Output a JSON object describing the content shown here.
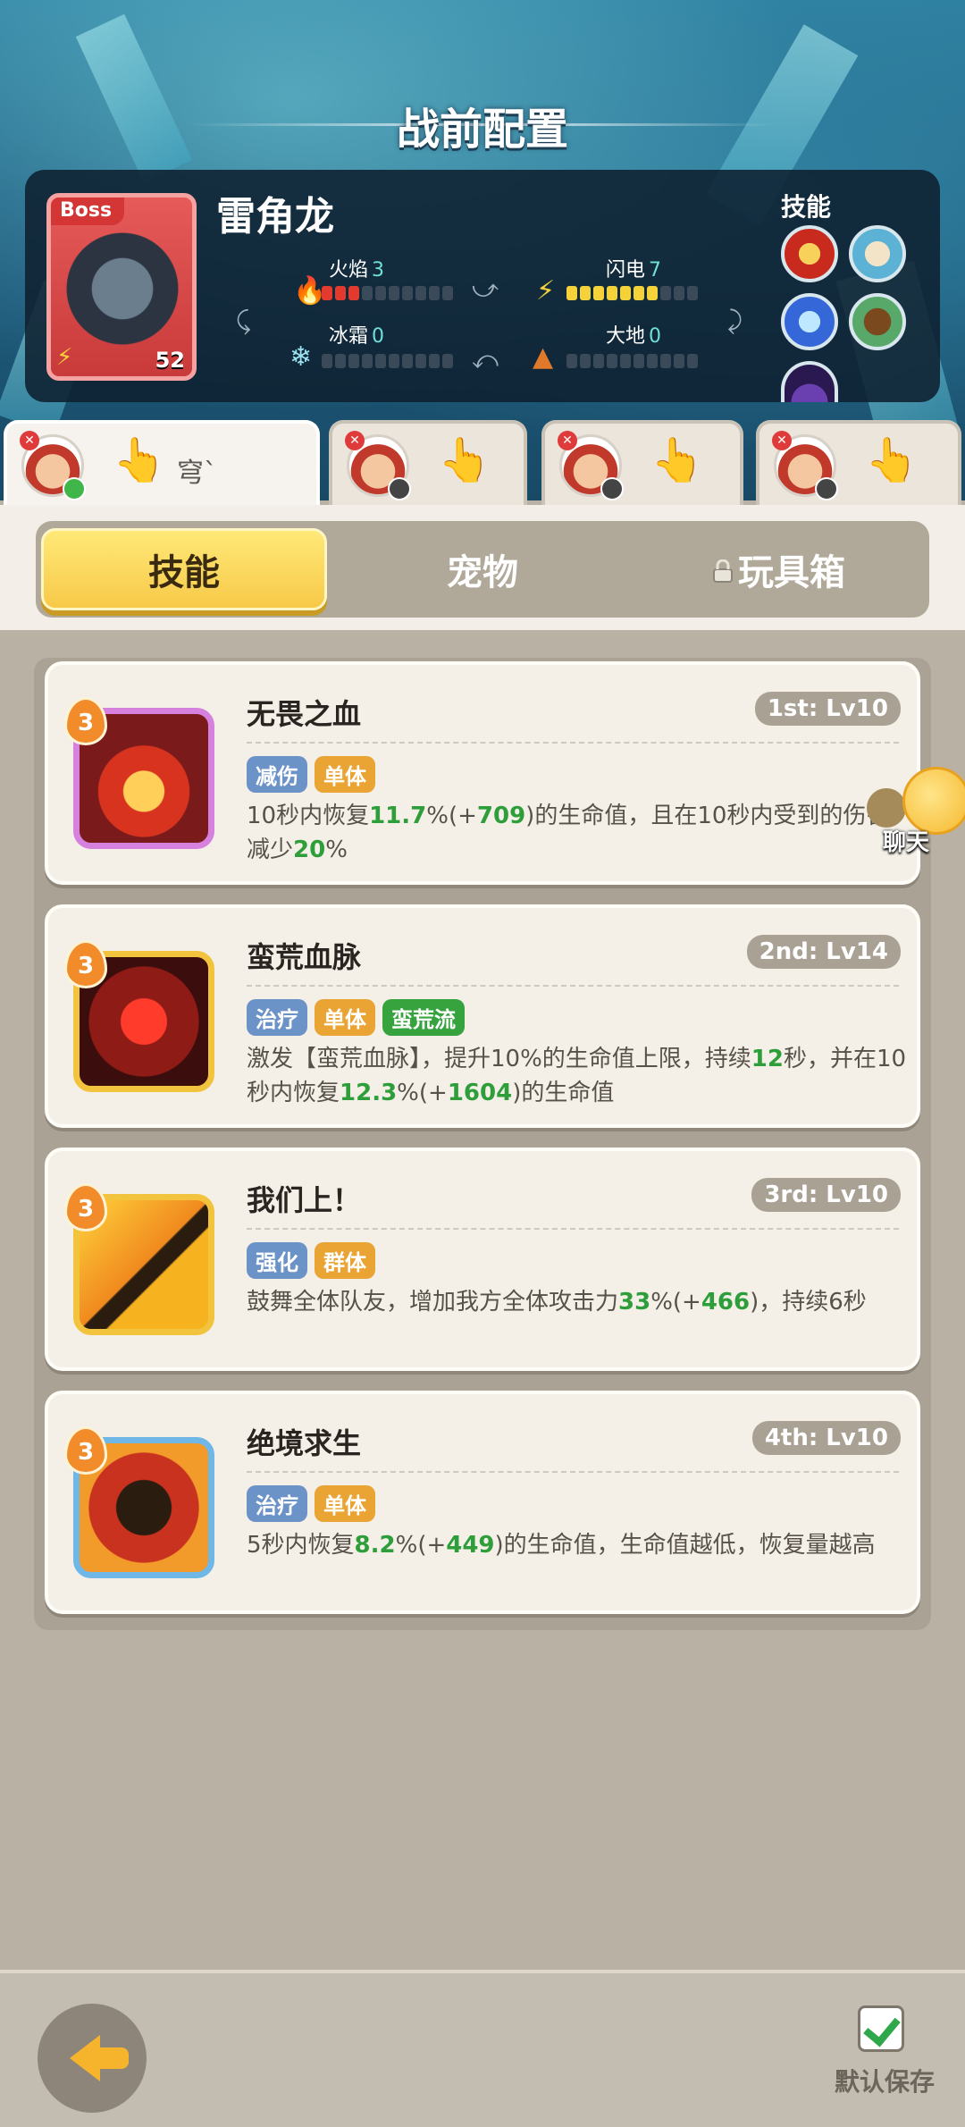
{
  "header": {
    "title": "战前配置"
  },
  "boss": {
    "tag": "Boss",
    "name": "雷角龙",
    "level": "52",
    "skills_label": "技能",
    "stats": [
      {
        "key": "fire",
        "label": "火焰",
        "value": "3",
        "filled": 3,
        "total": 10,
        "icon": "fire-drop-icon"
      },
      {
        "key": "thunder",
        "label": "闪电",
        "value": "7",
        "filled": 7,
        "total": 10,
        "icon": "lightning-icon"
      },
      {
        "key": "frost",
        "label": "冰霜",
        "value": "0",
        "filled": 0,
        "total": 10,
        "icon": "snowflake-icon"
      },
      {
        "key": "earth",
        "label": "大地",
        "value": "0",
        "filled": 0,
        "total": 10,
        "icon": "mountain-icon"
      }
    ],
    "skill_icons": [
      "fire-skill-icon",
      "shield-skill-icon",
      "lightning-skill-icon",
      "monster-skill-icon",
      "dark-skill-icon"
    ]
  },
  "hero_tabs": [
    {
      "active": true,
      "text": "穹`",
      "badge": "green"
    },
    {
      "active": false,
      "text": "",
      "badge": "dark"
    },
    {
      "active": false,
      "text": "",
      "badge": "dark"
    },
    {
      "active": false,
      "text": "",
      "badge": "dark"
    }
  ],
  "categories": [
    {
      "label": "技能",
      "active": true,
      "locked": false
    },
    {
      "label": "宠物",
      "active": false,
      "locked": false
    },
    {
      "label": "玩具箱",
      "active": false,
      "locked": true
    }
  ],
  "skills": [
    {
      "level": "3",
      "name": "无畏之血",
      "rank": "1st: Lv10",
      "tags": [
        {
          "text": "减伤",
          "color": "blue"
        },
        {
          "text": "单体",
          "color": "orange"
        }
      ],
      "desc_parts": [
        "10秒内恢复",
        "11.7",
        "%(+",
        "709",
        ")的生命值，且在10秒内受到的伤害减少",
        "20",
        "%"
      ],
      "icon_border": "#d781df",
      "icon_bg": "radial-gradient(circle at 50% 60%, #ffcf5a 0 20%, #d8331f 21% 45%, #7a1a1a 46% 100%)",
      "icon_name": "blood-drop-shield-icon"
    },
    {
      "level": "3",
      "name": "蛮荒血脉",
      "rank": "2nd: Lv14",
      "tags": [
        {
          "text": "治疗",
          "color": "blue"
        },
        {
          "text": "单体",
          "color": "orange"
        },
        {
          "text": "蛮荒流",
          "color": "green"
        }
      ],
      "desc_parts": [
        "激发【蛮荒血脉】，提升10%的生命值上限，持续",
        "12",
        "秒，并在10秒内恢复",
        "12.3",
        "%(+",
        "1604",
        ")的生命值"
      ],
      "icon_border": "#f2c33c",
      "icon_bg": "radial-gradient(circle at 50% 50%, #ff3b2b 0 25%, #8e1b16 26% 60%, #3b0d0c 61% 100%)",
      "icon_name": "blood-drop-icon"
    },
    {
      "level": "3",
      "name": "我们上！",
      "rank": "3rd: Lv10",
      "tags": [
        {
          "text": "强化",
          "color": "blue"
        },
        {
          "text": "群体",
          "color": "orange"
        }
      ],
      "desc_parts": [
        "鼓舞全体队友，增加我方全体攻击力",
        "33",
        "%(+",
        "466",
        ")，持续6秒"
      ],
      "icon_border": "#f2c33c",
      "icon_bg": "linear-gradient(135deg, #ffd23a 0%, #f08a1f 50%, #2a1d10 51%, #2a1d10 60%, #f6b21f 61%)",
      "icon_name": "charge-crowd-icon"
    },
    {
      "level": "3",
      "name": "绝境求生",
      "rank": "4th: Lv10",
      "tags": [
        {
          "text": "治疗",
          "color": "blue"
        },
        {
          "text": "单体",
          "color": "orange"
        }
      ],
      "desc_parts": [
        "5秒内恢复",
        "8.2",
        "%(+",
        "449",
        ")的生命值，生命值越低，恢复量越高"
      ],
      "icon_border": "#6fb7e6",
      "icon_bg": "radial-gradient(circle at 50% 50%, #2a1d10 0 30%, #c9321f 31% 60%, #f29a2a 61% 100%)",
      "icon_name": "survival-heal-icon"
    }
  ],
  "chat": {
    "label": "聊天"
  },
  "footer": {
    "save_label": "默认保存"
  }
}
